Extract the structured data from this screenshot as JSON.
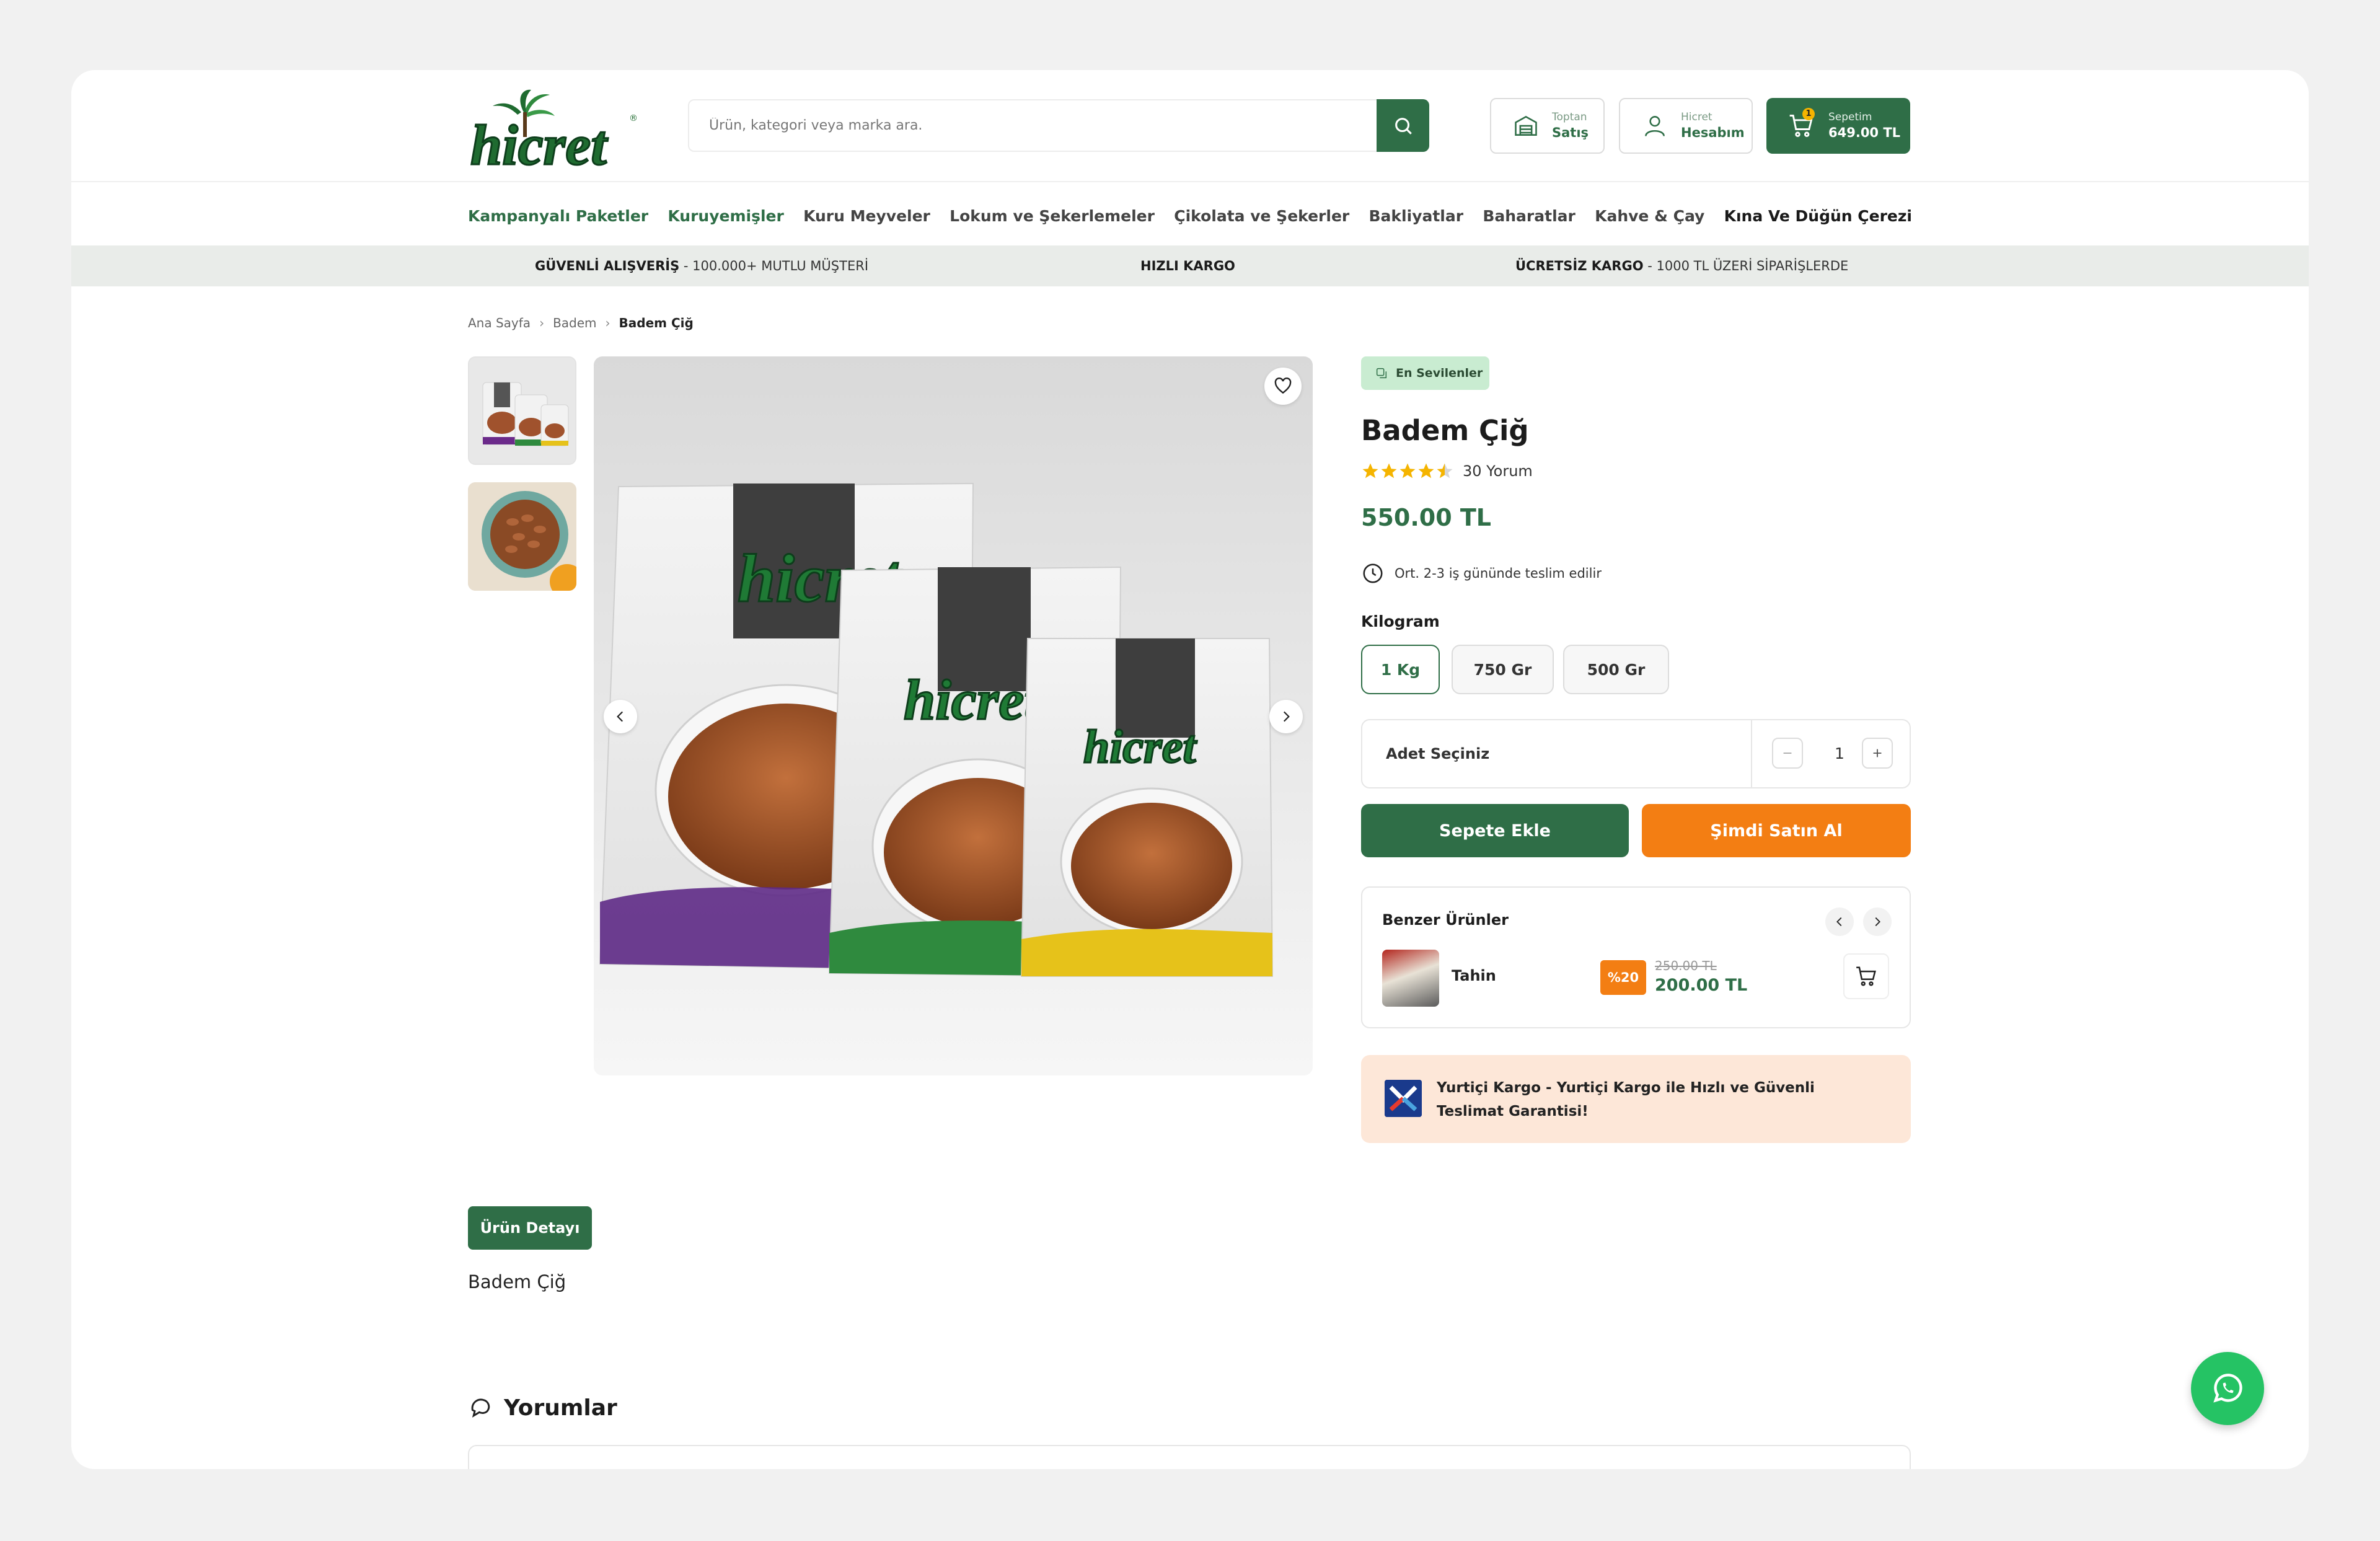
{
  "brand": {
    "logo_text": "hicret"
  },
  "search": {
    "placeholder": "Ürün, kategori veya marka ara."
  },
  "header": {
    "wholesale": {
      "line1": "Toptan",
      "line2": "Satış"
    },
    "account": {
      "line1": "Hicret",
      "line2": "Hesabım"
    },
    "cart": {
      "count": "1",
      "line1": "Sepetim",
      "line2": "649.00 TL"
    }
  },
  "nav": [
    "Kampanyalı Paketler",
    "Kuruyemişler",
    "Kuru Meyveler",
    "Lokum ve Şekerlemeler",
    "Çikolata ve Şekerler",
    "Bakliyatlar",
    "Baharatlar",
    "Kahve & Çay",
    "Kına Ve Düğün Çerezi"
  ],
  "infobar": {
    "item1_bold": "GÜVENLİ ALIŞVERİŞ",
    "item1_rest": " - 100.000+ MUTLU MÜŞTERİ",
    "item2_bold": "HIZLI KARGO",
    "item3_bold": "ÜCRETSİZ KARGO",
    "item3_rest": " - 1000 TL ÜZERİ SİPARİŞLERDE"
  },
  "breadcrumb": [
    "Ana Sayfa",
    "Badem",
    "Badem Çiğ"
  ],
  "product": {
    "tag": "En Sevilenler",
    "title": "Badem Çiğ",
    "rating": 4.5,
    "review_count": "30 Yorum",
    "price": "550.00 TL",
    "delivery": "Ort. 2-3 iş gününde teslim edilir",
    "option_label": "Kilogram",
    "options": [
      "1 Kg",
      "750 Gr",
      "500 Gr"
    ],
    "selected_option": "1 Kg",
    "qty_label": "Adet Seçiniz",
    "qty": "1",
    "add_to_cart": "Sepete Ekle",
    "buy_now": "Şimdi Satın Al"
  },
  "similar": {
    "title": "Benzer Ürünler",
    "items": [
      {
        "name": "Tahin",
        "discount": "%20",
        "old_price": "250.00 TL",
        "new_price": "200.00 TL"
      }
    ]
  },
  "shipping": {
    "text": "Yurtiçi Kargo - Yurtiçi Kargo ile Hızlı ve Güvenli Teslimat Garantisi!"
  },
  "detail": {
    "tab": "Ürün Detayı",
    "text": "Badem Çiğ"
  },
  "reviews": {
    "heading": "Yorumlar"
  },
  "colors": {
    "primary": "#2f6e47",
    "accent": "#f37e13",
    "tag_bg": "#c9ecd1",
    "ship_bg": "#fde7d8",
    "whatsapp": "#25c364"
  },
  "icons": [
    "search-icon",
    "warehouse-icon",
    "user-icon",
    "cart-icon",
    "heart-icon",
    "chevron-left-icon",
    "chevron-right-icon",
    "star-icon",
    "clock-icon",
    "minus-icon",
    "plus-icon",
    "comments-icon",
    "whatsapp-icon"
  ]
}
